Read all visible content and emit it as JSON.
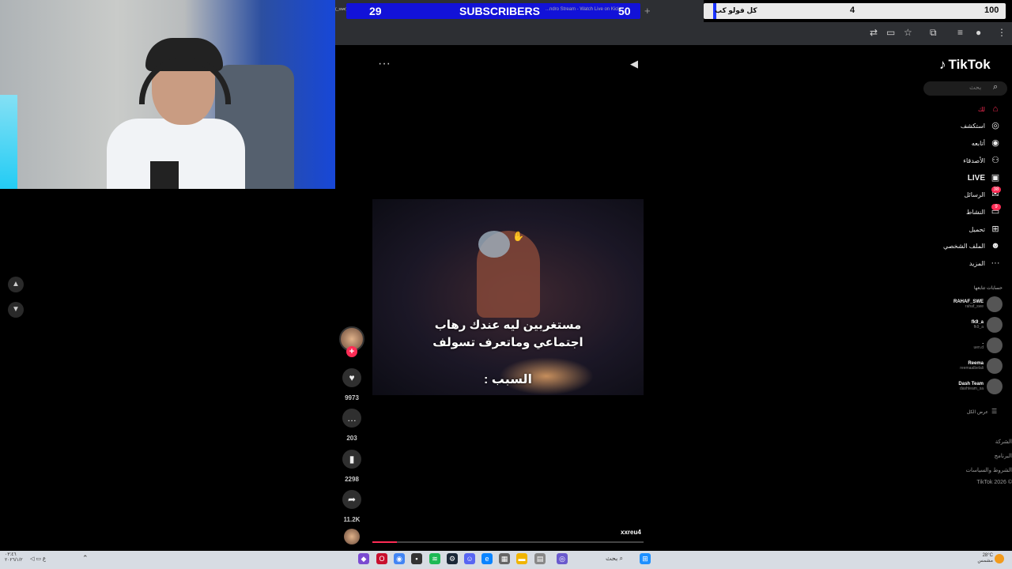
{
  "overlay": {
    "subscribers": {
      "current": "29",
      "label": "SUBSCRIBERS",
      "goal": "50"
    },
    "tab_title": "...ndro Stream - Watch Live on Kick",
    "tab_left_small": "(_swe)",
    "follow_goal": {
      "label": "كل فولو كب",
      "current": "4",
      "goal": "100",
      "progress_fraction": 0.04
    }
  },
  "tiktok": {
    "logo": "TikTok",
    "search_placeholder": "بحث",
    "nav": [
      {
        "label": "لك",
        "icon": "home-icon"
      },
      {
        "label": "استكشف",
        "icon": "compass-icon"
      },
      {
        "label": "أتابعه",
        "icon": "following-icon"
      },
      {
        "label": "الأصدقاء",
        "icon": "friends-icon"
      },
      {
        "label": "LIVE",
        "icon": "live-icon"
      },
      {
        "label": "الرسائل",
        "icon": "messages-icon",
        "badge": "38"
      },
      {
        "label": "النشاط",
        "icon": "activity-icon",
        "badge": "9"
      },
      {
        "label": "تحميل",
        "icon": "upload-icon"
      },
      {
        "label": "الملف الشخصي",
        "icon": "profile-icon"
      },
      {
        "label": "المزيد",
        "icon": "more-icon"
      }
    ],
    "following_title": "حسابات تتابعها",
    "following": [
      {
        "name": "RAHAF_SWE",
        "handle": "rahaf_swe"
      },
      {
        "name": "fk9_a",
        "handle": "fk9_a"
      },
      {
        "name": ".",
        "handle": "uen.d"
      },
      {
        "name": "Reema",
        "handle": "reemaalbelali"
      },
      {
        "name": "Dash Team",
        "handle": "dashteam_sa"
      }
    ],
    "see_all": "عرض الكل",
    "footer": [
      "الشركة",
      "البرنامج",
      "الشروط والسياسات",
      "TikTok 2026 ©"
    ],
    "video": {
      "caption_line1": "مستغربين ليه عندك رهاب",
      "caption_line2": "اجتماعي وماتعرف تسولف",
      "caption_line3": "السبب :",
      "author": "xxreu4",
      "progress_fraction": 0.09
    },
    "actions": {
      "likes": "9973",
      "comments": "203",
      "saves": "2298",
      "shares": "11.2K"
    }
  },
  "taskbar": {
    "clock": "٠٣:٤٦\n٢٠٢٦/١/٢",
    "lang": "ع",
    "search": "بحث",
    "weather_temp": "28°C",
    "weather_desc": "مشمس"
  },
  "colors": {
    "accent": "#fe2c55",
    "goal_bar": "#1212d8"
  }
}
